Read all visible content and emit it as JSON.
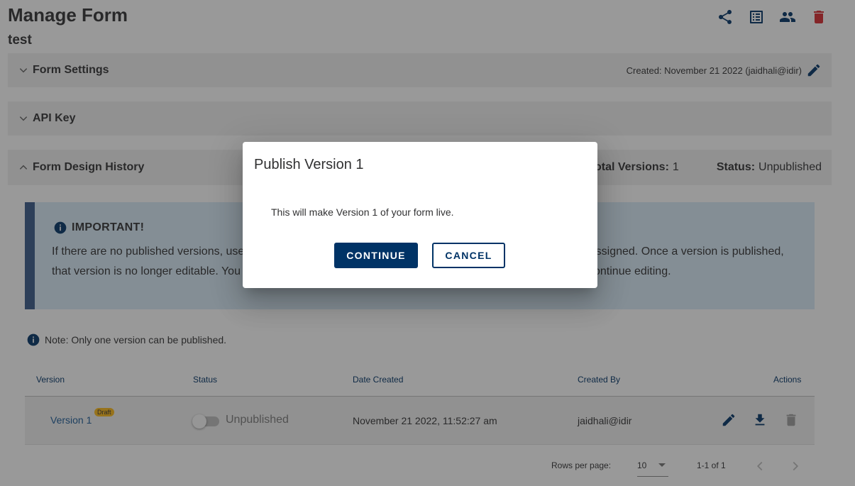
{
  "page": {
    "title": "Manage Form",
    "form_name": "test"
  },
  "toolbar": {
    "icons": [
      "share-icon",
      "list-icon",
      "people-icon",
      "delete-icon"
    ],
    "delete_color": "#d8292f"
  },
  "panels": {
    "settings": {
      "title": "Form Settings",
      "created_text": "Created: November 21 2022 (jaidhali@idir)"
    },
    "api_key": {
      "title": "API Key"
    },
    "history": {
      "title": "Form Design History",
      "total_versions_label": "Total Versions:",
      "total_versions_value": "1",
      "status_label": "Status:",
      "status_value": "Unpublished"
    }
  },
  "important": {
    "heading": "IMPORTANT!",
    "body": "If there are no published versions, users will not be able to access the form until a version is published and assigned. Once a version is published, that version is no longer editable. You can create a new version from an existing one in Design Versions to continue editing."
  },
  "note": {
    "text": "Note: Only one version can be published."
  },
  "table": {
    "headers": {
      "version": "Version",
      "status": "Status",
      "date_created": "Date Created",
      "created_by": "Created By",
      "actions": "Actions"
    },
    "rows": [
      {
        "version": "Version 1",
        "badge": "Draft",
        "published": false,
        "status": "Unpublished",
        "date_created": "November 21 2022, 11:52:27 am",
        "created_by": "jaidhali@idir"
      }
    ]
  },
  "pagination": {
    "rows_per_page_label": "Rows per page:",
    "rows_per_page_value": "10",
    "range": "1-1 of 1"
  },
  "dialog": {
    "title": "Publish Version 1",
    "message": "This will make Version 1 of your form live.",
    "continue_label": "CONTINUE",
    "cancel_label": "CANCEL"
  },
  "colors": {
    "primary": "#003366",
    "link": "#1a5a96",
    "panel_bg": "#f1f1f1",
    "info_bg": "#d9eaf7",
    "info_border": "#38598a",
    "badge": "#fcba19"
  }
}
